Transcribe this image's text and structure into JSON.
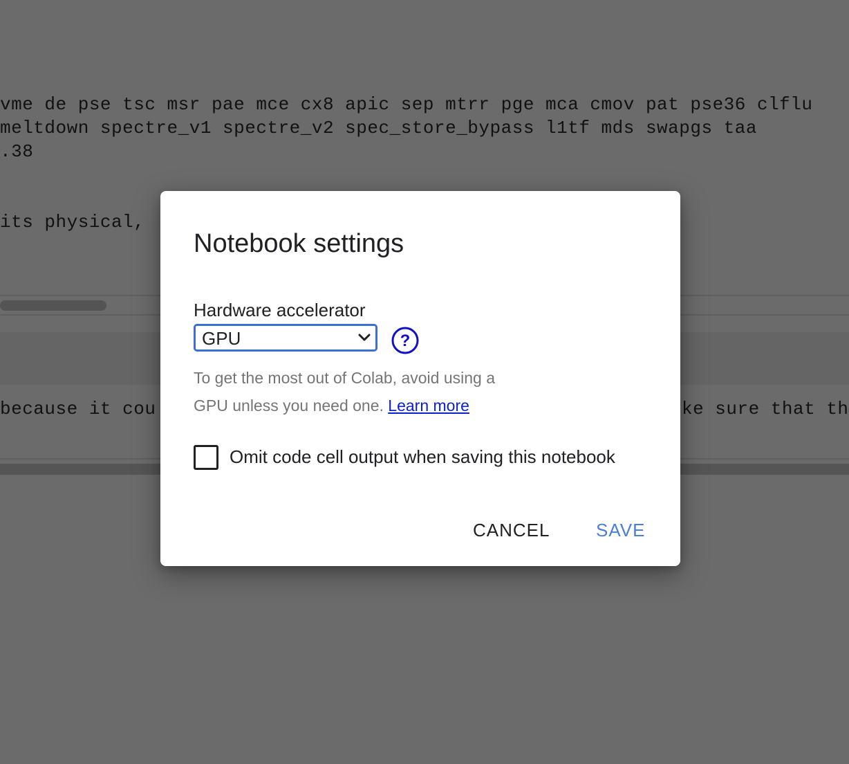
{
  "background": {
    "code_lines": [
      "vme de pse tsc msr pae mce cx8 apic sep mtrr pge mca cmov pat pse36 clflu",
      "meltdown spectre_v1 spectre_v2 spec_store_bypass l1tf mds swapgs taa",
      ".38",
      "its physical,",
      "because it cou",
      "ke sure that th"
    ]
  },
  "dialog": {
    "title": "Notebook settings",
    "accelerator": {
      "label": "Hardware accelerator",
      "selected": "GPU",
      "help_icon": "help-circle-icon"
    },
    "hint": {
      "text": "To get the most out of Colab, avoid using a GPU unless you need one.",
      "link_text": "Learn more"
    },
    "omit_output": {
      "label": "Omit code cell output when saving this notebook",
      "checked": false
    },
    "buttons": {
      "cancel_label": "CANCEL",
      "save_label": "SAVE"
    }
  },
  "colors": {
    "select_border": "#3b6ed6",
    "save_button": "#4a7fd9",
    "link": "#0b1fd1",
    "help_icon": "#1010c8"
  }
}
